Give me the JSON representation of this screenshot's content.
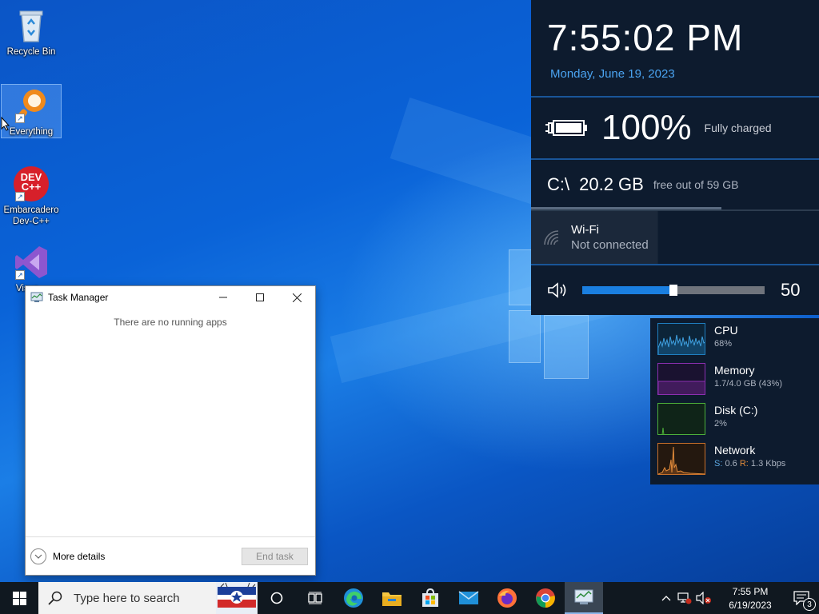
{
  "desktop": {
    "icons": [
      {
        "label": "Recycle Bin"
      },
      {
        "label": "Everything"
      },
      {
        "label": "Embarcadero\nDev-C++",
        "logo": "DEV\nC++"
      },
      {
        "label": "Visua..."
      }
    ]
  },
  "flyout": {
    "time": "7:55:02 PM",
    "date": "Monday, June 19, 2023",
    "battery": {
      "percent": "100%",
      "status": "Fully charged",
      "icon": "battery-charging-icon"
    },
    "disk": {
      "path": "C:\\",
      "free": "20.2 GB",
      "caption": "free out of 59 GB",
      "used_fraction": 0.66
    },
    "wifi": {
      "title": "Wi-Fi",
      "status": "Not connected",
      "icon": "wifi-icon"
    },
    "volume": {
      "value": "50",
      "level": 0.5,
      "icon": "speaker-icon"
    }
  },
  "perf": {
    "cpu": {
      "name": "CPU",
      "value": "68%",
      "color": "#1f7fc0"
    },
    "memory": {
      "name": "Memory",
      "value": "1.7/4.0 GB (43%)",
      "color": "#8b2fb0"
    },
    "disk": {
      "name": "Disk (C:)",
      "value": "2%",
      "color": "#4caf3a"
    },
    "network": {
      "name": "Network",
      "send_label": "S:",
      "send_value": "0.6",
      "recv_label": "R:",
      "recv_value": "1.3 Kbps",
      "color": "#c8702a"
    }
  },
  "taskmgr": {
    "title": "Task Manager",
    "empty_message": "There are no running apps",
    "more_details": "More details",
    "end_task": "End task"
  },
  "taskbar": {
    "search_placeholder": "Type here to search",
    "clock_time": "7:55 PM",
    "clock_date": "6/19/2023",
    "notification_count": "3",
    "apps": [
      "cortana-icon",
      "task-view-icon",
      "edge-icon",
      "file-explorer-icon",
      "store-icon",
      "mail-icon",
      "firefox-icon",
      "chrome-icon",
      "task-manager-icon"
    ]
  },
  "colors": {
    "accent": "#1a7fe0",
    "flyout_bg": "#0d1b2e",
    "taskbar_bg": "#101820"
  }
}
